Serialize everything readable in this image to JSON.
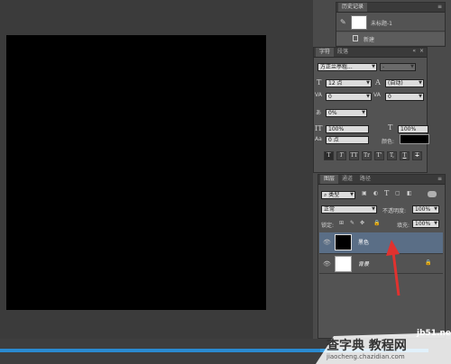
{
  "history": {
    "tabs": [
      "历史记录"
    ],
    "items": [
      {
        "label": "未标题-1"
      },
      {
        "label": "新建"
      }
    ]
  },
  "character": {
    "tabs": [
      "字符",
      "段落"
    ],
    "font_family": "方正兰亭粗...",
    "font_style": "-",
    "font_size": "12 点",
    "leading": "(自动)",
    "kerning": "0",
    "tracking": "0",
    "vertical_scale_small": "0%",
    "vertical_scale": "100%",
    "horizontal_scale": "100%",
    "baseline_shift": "0 点",
    "color_label": "颜色:",
    "text_color": "#000000",
    "style_buttons": [
      "T",
      "T",
      "TT",
      "Tr",
      "T'",
      "T,",
      "T",
      "T"
    ]
  },
  "layers": {
    "tabs": [
      "图层",
      "通道",
      "路径"
    ],
    "filter_type": "类型",
    "blend_mode": "正常",
    "opacity_label": "不透明度:",
    "opacity": "100%",
    "lock_label": "锁定:",
    "fill_label": "填充:",
    "fill": "100%",
    "items": [
      {
        "name": "黑色",
        "thumb_color": "#000000",
        "selected": true
      },
      {
        "name": "背景",
        "thumb_color": "#ffffff",
        "selected": false
      }
    ]
  },
  "watermark": {
    "line1": "jb51.net",
    "line2": "查字典 教程网",
    "line3": "jiaocheng.chazidian.com"
  },
  "colors": {
    "selection": "#5a6e86",
    "annotation_arrow": "#e0322f",
    "artboard": "#000000"
  }
}
